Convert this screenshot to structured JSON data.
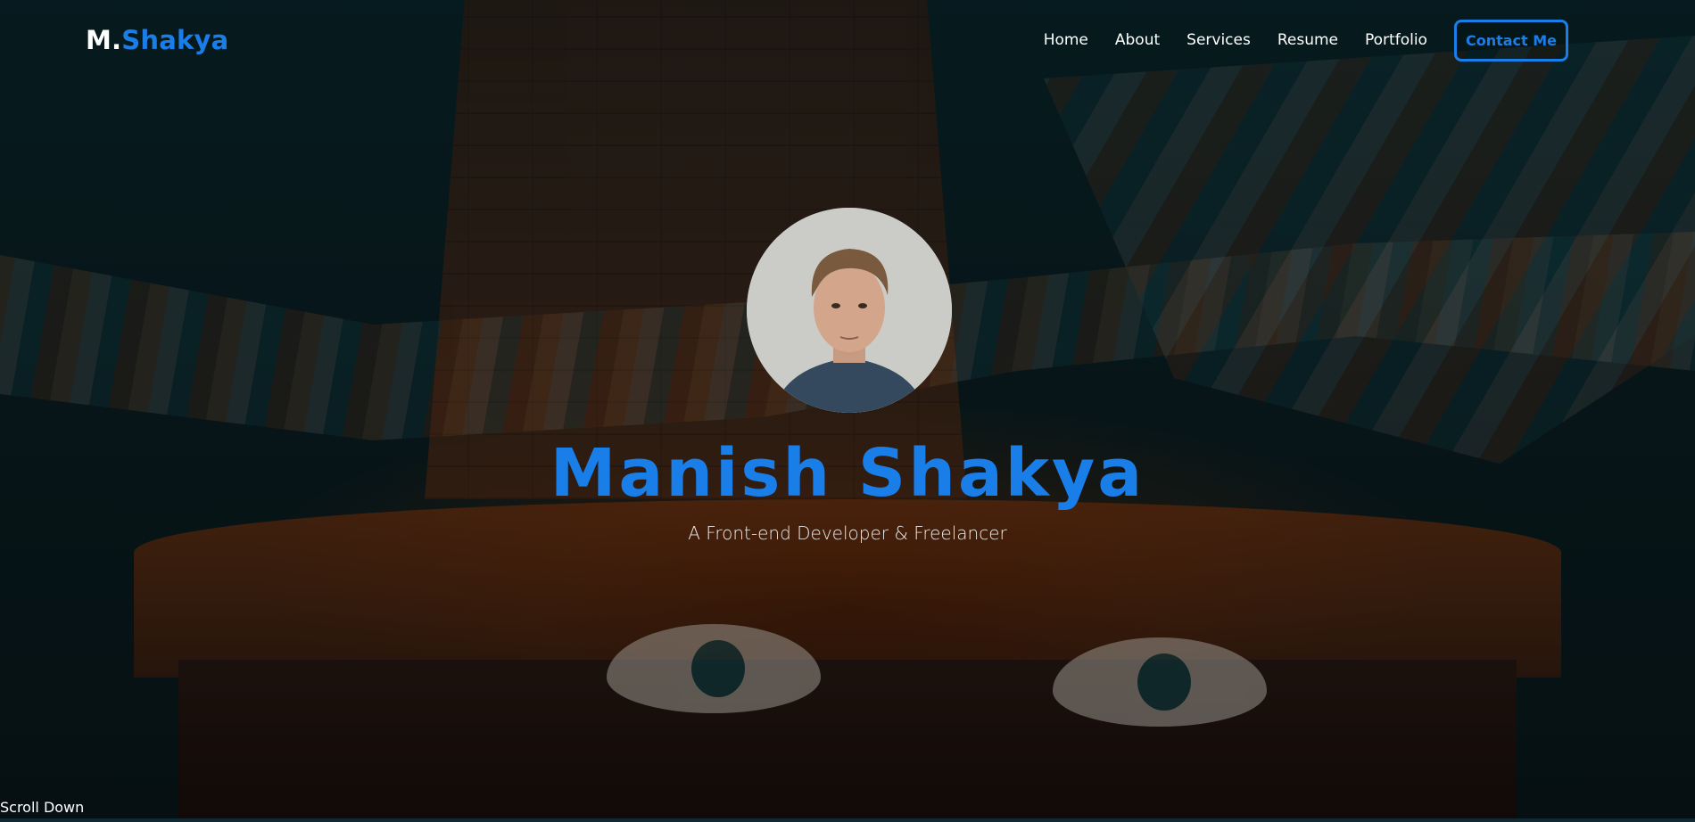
{
  "header": {
    "logo_prefix": "M.",
    "logo_suffix": "Shakya",
    "nav_items": [
      "Home",
      "About",
      "Services",
      "Resume",
      "Portfolio"
    ],
    "contact_label": "Contact Me"
  },
  "hero": {
    "name": "Manish Shakya",
    "tagline": "A Front-end Developer & Freelancer",
    "scroll_label": "Scroll Down"
  },
  "colors": {
    "accent": "#1a7ee8",
    "text": "#ffffff",
    "background": "#061a20"
  }
}
